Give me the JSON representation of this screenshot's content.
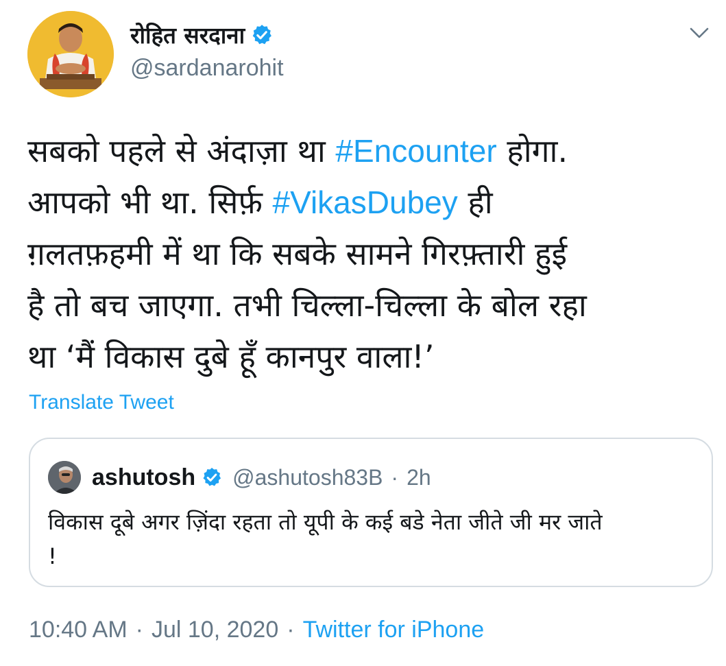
{
  "author": {
    "display_name": "रोहित सरदाना",
    "handle": "@sardanarohit",
    "verified_icon": "verified-badge-icon",
    "avatar": "avatar-photo"
  },
  "menu": {
    "icon": "chevron-down-icon"
  },
  "tweet": {
    "lines": [
      [
        {
          "text": "सबको पहले से अंदाज़ा था "
        },
        {
          "text": "#Encounter",
          "hashtag": true
        },
        {
          "text": " होगा."
        }
      ],
      [
        {
          "text": "आपको भी था. सिर्फ़ "
        },
        {
          "text": "#VikasDubey",
          "hashtag": true
        },
        {
          "text": " ही"
        }
      ],
      [
        {
          "text": "ग़लतफ़हमी में था कि सबके सामने गिरफ़्तारी हुई"
        }
      ],
      [
        {
          "text": "है तो बच जाएगा. तभी चिल्ला-चिल्ला के बोल रहा"
        }
      ],
      [
        {
          "text": "था ‘मैं विकास दुबे हूँ कानपुर वाला!’"
        }
      ]
    ],
    "translate_label": "Translate Tweet"
  },
  "quoted_tweet": {
    "display_name": "ashutosh",
    "handle": "@ashutosh83B",
    "separator": "·",
    "time": "2h",
    "lines": [
      "विकास दूबे अगर ज़िंदा रहता तो यूपी के कई बडे नेता जीते जी मर जाते",
      "!"
    ]
  },
  "meta": {
    "time": "10:40 AM",
    "separator": "·",
    "date": "Jul 10, 2020",
    "source": "Twitter for iPhone"
  },
  "colors": {
    "link": "#1da1f2",
    "secondary_text": "#657786",
    "primary_text": "#14171a",
    "border": "#d5dce2"
  }
}
